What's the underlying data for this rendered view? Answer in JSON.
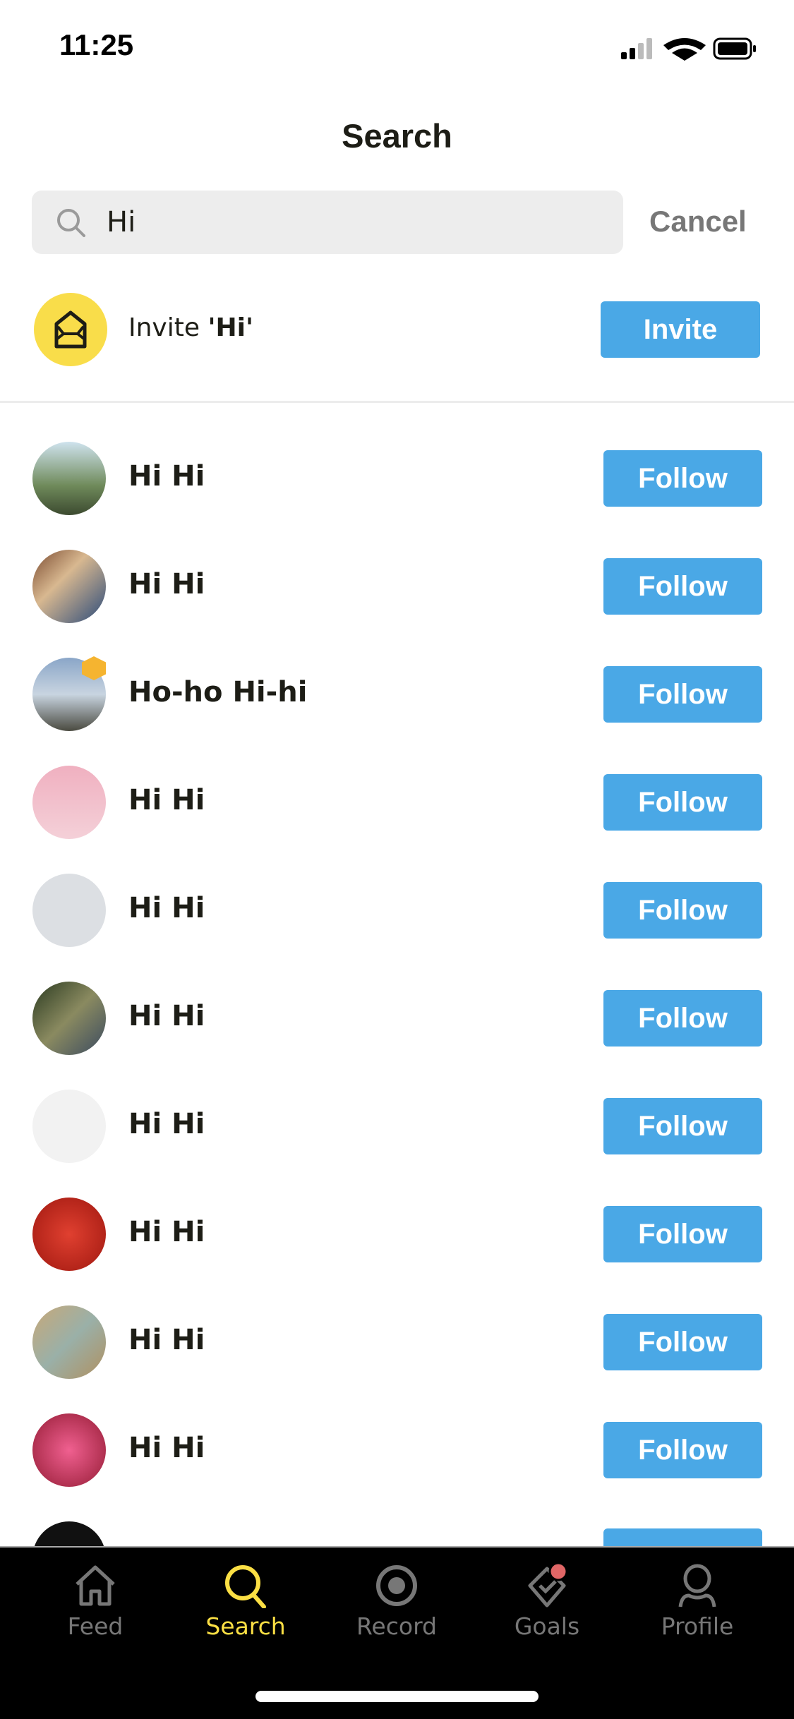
{
  "status_bar": {
    "time": "11:25"
  },
  "header": {
    "title": "Search"
  },
  "search": {
    "value": "Hi",
    "cancel_label": "Cancel"
  },
  "invite": {
    "prefix": "Invite ",
    "query": "'Hi'",
    "button_label": "Invite",
    "icon": "envelope-open-icon"
  },
  "results": [
    {
      "name": "Hi Hi",
      "button": "Follow"
    },
    {
      "name": "Hi Hi",
      "button": "Follow"
    },
    {
      "name": "Ho-ho Hi-hi",
      "button": "Follow",
      "badge": true
    },
    {
      "name": "Hi Hi",
      "button": "Follow"
    },
    {
      "name": "Hi Hi",
      "button": "Follow"
    },
    {
      "name": "Hi Hi",
      "button": "Follow"
    },
    {
      "name": "Hi Hi",
      "button": "Follow"
    },
    {
      "name": "Hi Hi",
      "button": "Follow"
    },
    {
      "name": "Hi Hi",
      "button": "Follow"
    },
    {
      "name": "Hi Hi",
      "button": "Follow"
    }
  ],
  "tabs": [
    {
      "label": "Feed",
      "icon": "home-icon"
    },
    {
      "label": "Search",
      "icon": "search-icon",
      "active": true
    },
    {
      "label": "Record",
      "icon": "record-icon"
    },
    {
      "label": "Goals",
      "icon": "goals-icon",
      "badge": true
    },
    {
      "label": "Profile",
      "icon": "profile-icon"
    }
  ],
  "colors": {
    "accent": "#4aa8e6",
    "active_tab": "#fbdf44",
    "invite_circle": "#f9dd4a",
    "badge": "#e06666"
  }
}
